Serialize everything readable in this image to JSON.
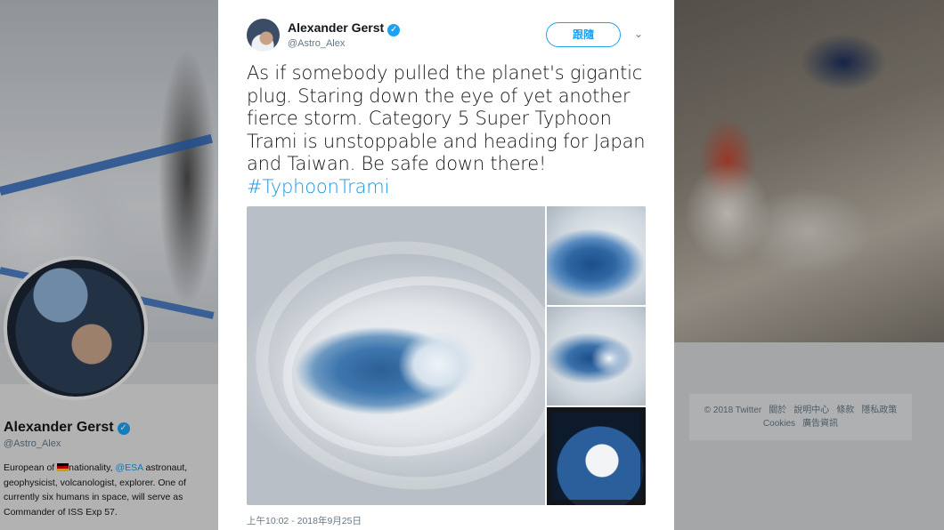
{
  "profile": {
    "name": "Alexander Gerst",
    "handle": "@Astro_Alex",
    "bio_part1": "European of ",
    "bio_part2": "nationality, ",
    "bio_link": "@ESA",
    "bio_part3": " astronaut, geophysicist, volcanologist, explorer. One of currently six humans in space, will serve as Commander of ISS Exp 57."
  },
  "footer": {
    "items": [
      "© 2018 Twitter",
      "關於",
      "說明中心",
      "條款",
      "隱私政策",
      "Cookies",
      "廣告資訊"
    ]
  },
  "tweet": {
    "author_name": "Alexander Gerst",
    "author_handle": "@Astro_Alex",
    "verified_symbol": "✓",
    "follow_label": "跟隨",
    "caret_symbol": "⌄",
    "text": "As if somebody pulled the planet's gigantic plug. Staring down the eye of yet another fierce storm. Category 5 Super Typhoon Trami is unstoppable and heading for Japan and Taiwan. Be safe down there!",
    "hashtag": "#TyphoonTrami",
    "timestamp": "上午10:02 - 2018年9月25日",
    "media_count": 4
  },
  "colors": {
    "accent": "#1da1f2",
    "link": "#1b95e0",
    "text": "#14171a",
    "muted": "#657786"
  },
  "icons": {
    "verified": "verified-badge-icon",
    "caret": "chevron-down-icon",
    "flag": "germany-flag-icon"
  }
}
